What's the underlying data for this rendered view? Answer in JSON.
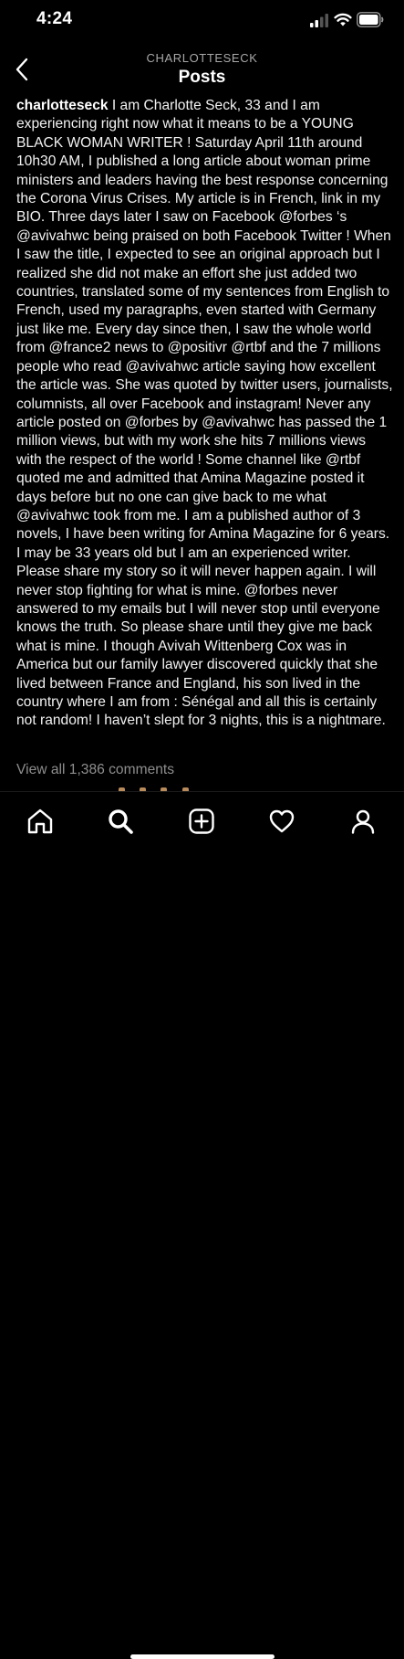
{
  "status_bar": {
    "time": "4:24",
    "icons": [
      "cellular-signal-icon",
      "wifi-icon",
      "battery-icon"
    ]
  },
  "header": {
    "account": "CHARLOTTESECK",
    "title": "Posts",
    "back_icon": "chevron-left-icon"
  },
  "post": {
    "username": "charlotteseck",
    "caption_segments": [
      {
        "type": "text",
        "text": " I am Charlotte Seck, 33 and I am experiencing right now what it means to be a YOUNG BLACK WOMAN WRITER ! Saturday April 11th around 10h30 AM, I published a long article about woman prime ministers and leaders having the best response concerning the Corona Virus Crises. My article is in French, link in my BIO. Three days later I saw on Facebook "
      },
      {
        "type": "mention",
        "text": "@forbes"
      },
      {
        "type": "text",
        "text": " ‘s "
      },
      {
        "type": "mention",
        "text": "@avivahwc"
      },
      {
        "type": "text",
        "text": " being praised on both Facebook Twitter ! When I saw the title, I expected to see an original approach but I realized she did not make an effort she just added two countries, translated some of my sentences from English to French, used my paragraphs, even started with Germany just like me. Every day since then, I saw the whole world from "
      },
      {
        "type": "mention",
        "text": "@france2"
      },
      {
        "type": "text",
        "text": " news to "
      },
      {
        "type": "mention",
        "text": "@positivr"
      },
      {
        "type": "text",
        "text": " "
      },
      {
        "type": "mention",
        "text": "@rtbf"
      },
      {
        "type": "text",
        "text": " and the 7 millions people who read "
      },
      {
        "type": "mention",
        "text": "@avivahwc"
      },
      {
        "type": "text",
        "text": " article saying how excellent the article was. She was quoted by twitter users, journalists, columnists, all over Facebook and instagram! Never any article posted on "
      },
      {
        "type": "mention",
        "text": "@forbes"
      },
      {
        "type": "text",
        "text": " by "
      },
      {
        "type": "mention",
        "text": "@avivahwc"
      },
      {
        "type": "text",
        "text": " has passed the 1 million views, but with my work she hits 7 millions views with the respect of the world ! Some channel like "
      },
      {
        "type": "mention",
        "text": "@rtbf"
      },
      {
        "type": "text",
        "text": " quoted me and admitted that Amina Magazine posted it days before but no one can give back to me what "
      },
      {
        "type": "mention",
        "text": "@avivahwc"
      },
      {
        "type": "text",
        "text": " took from me. I am a published author of 3 novels, I have been writing for Amina Magazine for 6 years. I may be 33 years old but I am an experienced writer. Please share my story so it will never happen again. I will never stop fighting for what is mine. "
      },
      {
        "type": "mention",
        "text": "@forbes"
      },
      {
        "type": "text",
        "text": " never answered to my emails but I will never stop until everyone knows the truth. So please share until they give me back what is mine. I though Avivah Wittenberg Cox was in America but our family lawyer discovered quickly that she lived between France and England, his son lived in the country where I am from : Sénégal and all this is certainly not random!  I haven’t slept for 3 nights, this is a nightmare."
      }
    ],
    "view_comments": "View all 1,386 comments"
  },
  "tab_bar": {
    "items": [
      {
        "name": "home",
        "icon": "home-icon"
      },
      {
        "name": "search",
        "icon": "search-icon"
      },
      {
        "name": "create",
        "icon": "add-post-icon"
      },
      {
        "name": "activity",
        "icon": "heart-icon"
      },
      {
        "name": "profile",
        "icon": "profile-icon"
      }
    ]
  }
}
